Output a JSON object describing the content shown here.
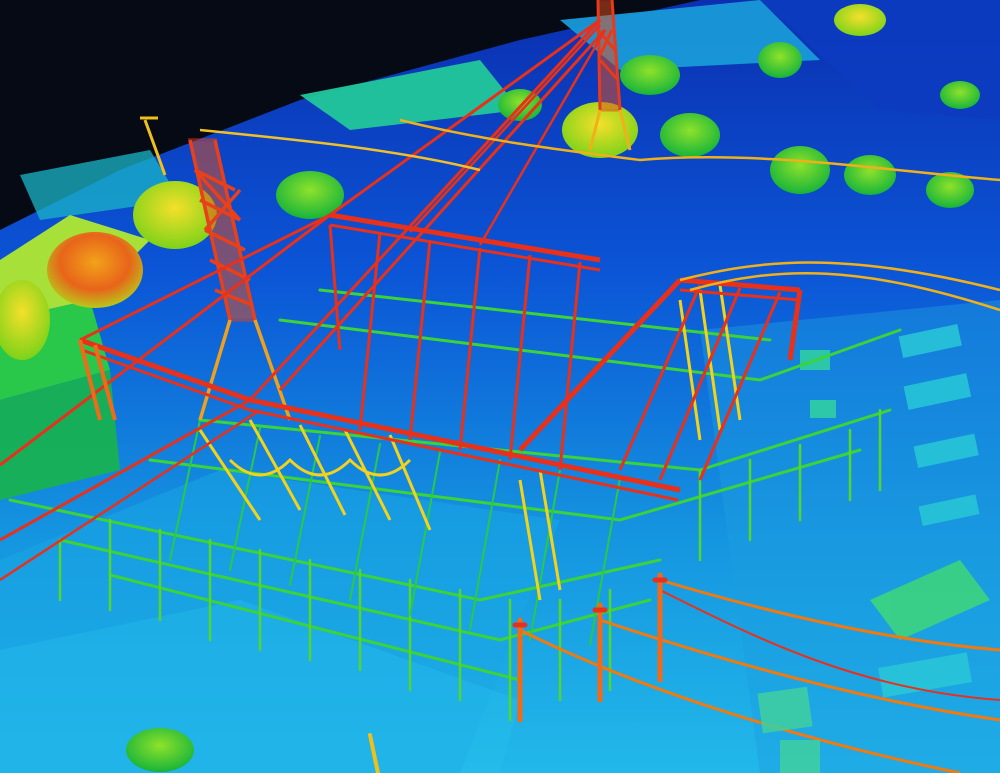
{
  "image": {
    "kind": "lidar-point-cloud",
    "subject": "electrical-substation-with-transmission-lines",
    "colormap": "height",
    "palette": {
      "sky": "#050a14",
      "ground_low": "#0a64c8",
      "ground_high": "#1fb4e6",
      "cyan": "#20d2f0",
      "green": "#34d23a",
      "lime": "#a8e020",
      "yellow": "#f2d21a",
      "orange": "#f07a10",
      "red": "#e8301a"
    }
  }
}
